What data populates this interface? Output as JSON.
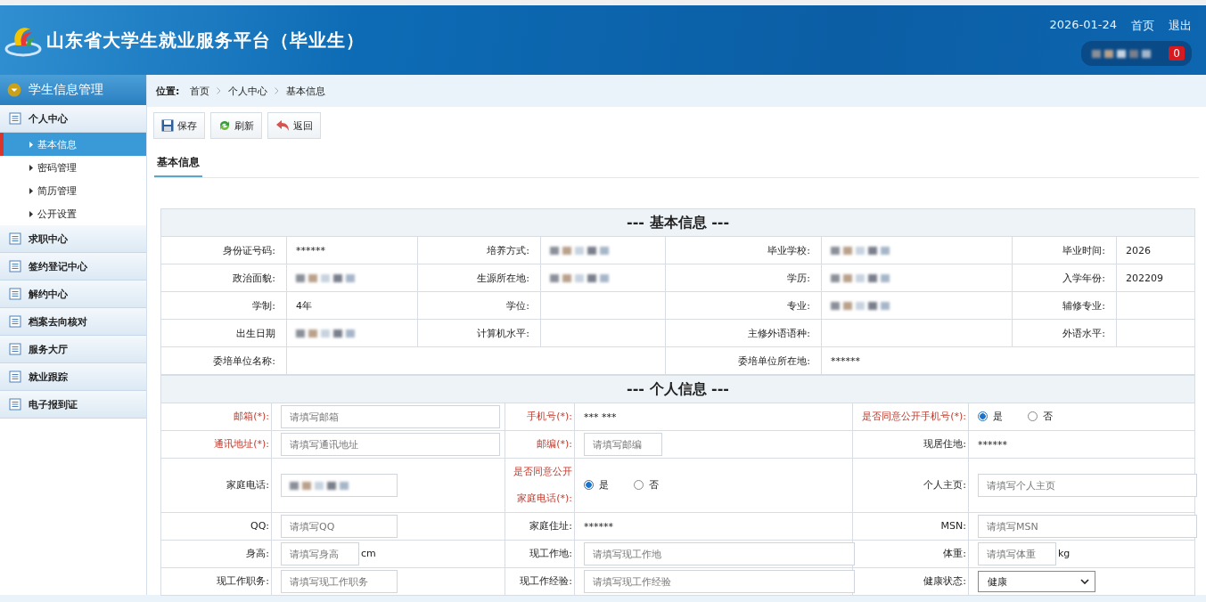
{
  "header": {
    "title": "山东省大学生就业服务平台（毕业生）",
    "date": "2026-01-24",
    "links": [
      "首页",
      "退出"
    ],
    "badge": "0"
  },
  "sidebar": {
    "title": "学生信息管理",
    "groups": [
      {
        "label": "个人中心",
        "children": [
          {
            "label": "基本信息",
            "selected": true
          },
          {
            "label": "密码管理",
            "selected": false
          },
          {
            "label": "简历管理",
            "selected": false
          },
          {
            "label": "公开设置",
            "selected": false
          }
        ]
      },
      {
        "label": "求职中心"
      },
      {
        "label": "签约登记中心"
      },
      {
        "label": "解约中心"
      },
      {
        "label": "档案去向核对"
      },
      {
        "label": "服务大厅"
      },
      {
        "label": "就业跟踪"
      },
      {
        "label": "电子报到证"
      }
    ]
  },
  "breadcrumb": {
    "label": "位置:",
    "items": [
      "首页",
      "个人中心",
      "基本信息"
    ]
  },
  "toolbar": [
    {
      "kind": "save",
      "label": "保存"
    },
    {
      "kind": "refresh",
      "label": "刷新"
    },
    {
      "kind": "back",
      "label": "返回"
    }
  ],
  "tabs": [
    {
      "label": "基本信息",
      "selected": true
    }
  ],
  "sections": [
    {
      "title": "--- 基本信息 ---",
      "rows": [
        [
          {
            "kind": "label",
            "text": "身份证号码:",
            "required": false
          },
          {
            "kind": "text",
            "text": "******"
          },
          {
            "kind": "label",
            "text": "培养方式:",
            "required": false
          },
          {
            "kind": "blur"
          },
          {
            "kind": "label",
            "text": "毕业学校:",
            "required": false
          },
          {
            "kind": "blur"
          },
          {
            "kind": "label",
            "text": "毕业时间:",
            "required": false
          },
          {
            "kind": "text",
            "text": "2026"
          }
        ],
        [
          {
            "kind": "label",
            "text": "政治面貌:",
            "required": false
          },
          {
            "kind": "blur"
          },
          {
            "kind": "label",
            "text": "生源所在地:",
            "required": false
          },
          {
            "kind": "blur"
          },
          {
            "kind": "label",
            "text": "学历:",
            "required": false
          },
          {
            "kind": "blur"
          },
          {
            "kind": "label",
            "text": "入学年份:",
            "required": false
          },
          {
            "kind": "text",
            "text": "202209"
          }
        ],
        [
          {
            "kind": "label",
            "text": "学制:",
            "required": false
          },
          {
            "kind": "text",
            "text": "4年"
          },
          {
            "kind": "label",
            "text": "学位:",
            "required": false
          },
          "",
          {
            "kind": "label",
            "text": "专业:",
            "required": false
          },
          {
            "kind": "blur"
          },
          {
            "kind": "label",
            "text": "辅修专业:",
            "required": false
          },
          ""
        ],
        [
          {
            "kind": "label",
            "text": "出生日期",
            "required": false
          },
          {
            "kind": "blur"
          },
          {
            "kind": "label",
            "text": "计算机水平:",
            "required": false
          },
          "",
          {
            "kind": "label",
            "text": "主修外语语种:",
            "required": false
          },
          "",
          {
            "kind": "label",
            "text": "外语水平:",
            "required": false
          },
          ""
        ],
        [
          {
            "kind": "label",
            "text": "委培单位名称:",
            "required": false
          },
          "",
          "",
          "",
          {
            "kind": "label",
            "text": "委培单位所在地:",
            "required": false
          },
          {
            "kind": "text",
            "text": "******"
          },
          "",
          ""
        ]
      ]
    },
    {
      "title": "--- 个人信息 ---",
      "rows": [
        [
          {
            "kind": "label",
            "text": "邮箱(*):",
            "required": true
          },
          {
            "kind": "input",
            "placeholder": "请填写邮箱"
          },
          {
            "kind": "label",
            "text": "手机号(*):",
            "required": true
          },
          {
            "kind": "text",
            "text": "*** ***"
          },
          {
            "kind": "label",
            "text": "是否同意公开手机号(*):",
            "required": true
          },
          {
            "kind": "radio",
            "options": [
              {
                "label": "是",
                "selected": true
              },
              {
                "label": "否",
                "selected": false
              }
            ]
          }
        ],
        [
          {
            "kind": "label",
            "text": "通讯地址(*):",
            "required": true
          },
          {
            "kind": "input",
            "placeholder": "请填写通讯地址"
          },
          {
            "kind": "label",
            "text": "邮编(*):",
            "required": true
          },
          {
            "kind": "input",
            "placeholder": "请填写邮编"
          },
          {
            "kind": "label",
            "text": "现居住地:",
            "required": false
          },
          {
            "kind": "text",
            "text": "******"
          }
        ],
        [
          {
            "kind": "label",
            "text": "家庭电话:",
            "required": false
          },
          {
            "kind": "input_blur"
          },
          {
            "kind": "label",
            "text": "是否同意公开家庭电话(*):",
            "required": true
          },
          {
            "kind": "radio",
            "options": [
              {
                "label": "是",
                "selected": true
              },
              {
                "label": "否",
                "selected": false
              }
            ]
          },
          {
            "kind": "label",
            "text": "个人主页:",
            "required": false
          },
          {
            "kind": "input",
            "placeholder": "请填写个人主页"
          }
        ],
        [
          {
            "kind": "label",
            "text": "QQ:",
            "required": false
          },
          {
            "kind": "input",
            "placeholder": "请填写QQ"
          },
          {
            "kind": "label",
            "text": "家庭住址:",
            "required": false
          },
          {
            "kind": "text",
            "text": "******"
          },
          {
            "kind": "label",
            "text": "MSN:",
            "required": false
          },
          {
            "kind": "input",
            "placeholder": "请填写MSN"
          }
        ],
        [
          {
            "kind": "label",
            "text": "身高:",
            "required": false
          },
          {
            "kind": "input",
            "placeholder": "请填写身高",
            "suffix": "cm"
          },
          {
            "kind": "label",
            "text": "现工作地:",
            "required": false
          },
          {
            "kind": "input",
            "placeholder": "请填写现工作地"
          },
          {
            "kind": "label",
            "text": "体重:",
            "required": false
          },
          {
            "kind": "input",
            "placeholder": "请填写体重",
            "suffix": "kg"
          }
        ],
        [
          {
            "kind": "label",
            "text": "现工作职务:",
            "required": false
          },
          {
            "kind": "input",
            "placeholder": "请填写现工作职务"
          },
          {
            "kind": "label",
            "text": "现工作经验:",
            "required": false
          },
          {
            "kind": "input",
            "placeholder": "请填写现工作经验"
          },
          {
            "kind": "label",
            "text": "健康状态:",
            "required": false
          },
          {
            "kind": "select",
            "value": "健康"
          }
        ]
      ]
    }
  ]
}
